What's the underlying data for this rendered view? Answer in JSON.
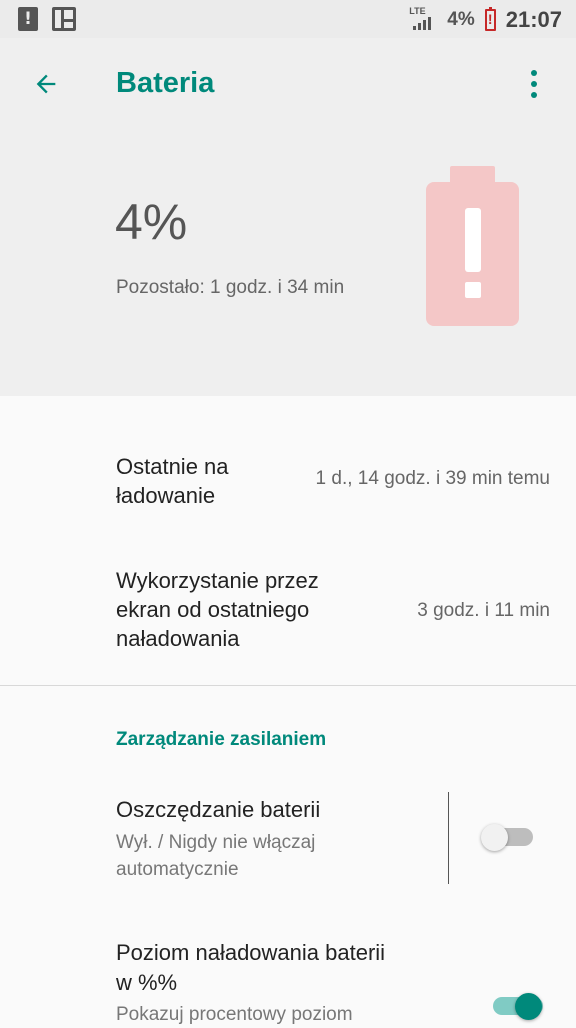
{
  "status_bar": {
    "network": "LTE",
    "battery_percent": "4%",
    "time": "21:07"
  },
  "app_bar": {
    "title": "Bateria",
    "back_icon": "arrow-back-icon",
    "menu_icon": "more-vert-icon"
  },
  "header": {
    "percent": "4%",
    "remaining": "Pozostało: 1 godz. i 34 min",
    "battery_icon": "battery-alert-icon",
    "battery_color": "#f4c7c7"
  },
  "rows": [
    {
      "title_line1": "Ostatnie na",
      "title_line2": "ładowanie",
      "value": "1 d., 14 godz. i 39 min temu"
    },
    {
      "title_line1": "Wykorzystanie przez",
      "title_line2": "ekran od ostatniego",
      "title_line3": "naładowania",
      "value": "3 godz. i 11 min"
    }
  ],
  "section_header": "Zarządzanie zasilaniem",
  "prefs": [
    {
      "title": "Oszczędzanie baterii",
      "sub_line1": "Wył. / Nigdy nie włączaj",
      "sub_line2": "automatycznie",
      "enabled": false
    },
    {
      "title_line1": "Poziom naładowania baterii",
      "title_line2": "w %%",
      "sub_line1": "Pokazuj procentowy poziom",
      "enabled": true
    }
  ],
  "colors": {
    "accent": "#00897b",
    "status_alert": "#c62828"
  }
}
